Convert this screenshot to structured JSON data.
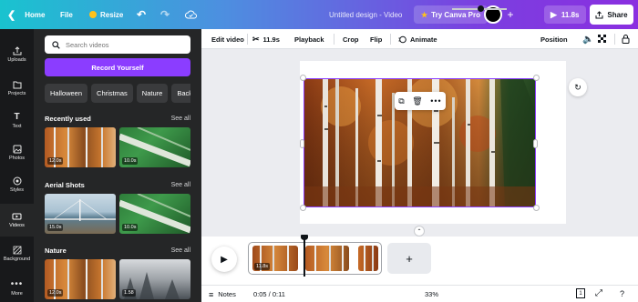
{
  "topbar": {
    "home_label": "Home",
    "file_label": "File",
    "resize_label": "Resize",
    "title": "Untitled design - Video",
    "try_canva_pro_label": "Try Canva Pro",
    "present_duration": "11.8s",
    "share_label": "Share",
    "gradient_colors": [
      "#19c3cf",
      "#4d8fe0",
      "#7b3fe0",
      "#8a2fe0"
    ]
  },
  "rail": {
    "items": [
      {
        "label": "Uploads",
        "icon": "upload-icon"
      },
      {
        "label": "Projects",
        "icon": "folder-icon"
      },
      {
        "label": "Text",
        "icon": "text-icon"
      },
      {
        "label": "Photos",
        "icon": "photos-icon"
      },
      {
        "label": "Styles",
        "icon": "styles-icon"
      },
      {
        "label": "Videos",
        "icon": "videos-icon",
        "active": true
      },
      {
        "label": "Background",
        "icon": "background-icon"
      },
      {
        "label": "More",
        "icon": "more-icon"
      }
    ]
  },
  "panel": {
    "search_placeholder": "Search videos",
    "record_label": "Record Yourself",
    "record_color": "#8b3dff",
    "chips": [
      "Halloween",
      "Christmas",
      "Nature",
      "Backg"
    ],
    "sections": [
      {
        "title": "Recently used",
        "see_all": "See all",
        "durations": [
          "12.0s",
          "10.0s"
        ]
      },
      {
        "title": "Aerial Shots",
        "see_all": "See all",
        "durations": [
          "15.0s",
          "10.0s"
        ]
      },
      {
        "title": "Nature",
        "see_all": "See all",
        "durations": [
          "12.0s",
          "1.58"
        ]
      }
    ]
  },
  "ctxbar": {
    "edit_video": "Edit video",
    "trim_duration": "11.9s",
    "playback": "Playback",
    "crop": "Crop",
    "flip": "Flip",
    "animate": "Animate",
    "position": "Position"
  },
  "timeline": {
    "first_clip_duration": "11.8s"
  },
  "statusbar": {
    "notes_label": "Notes",
    "time": "0:05 / 0:11",
    "zoom": "33%",
    "page_number": "1"
  }
}
